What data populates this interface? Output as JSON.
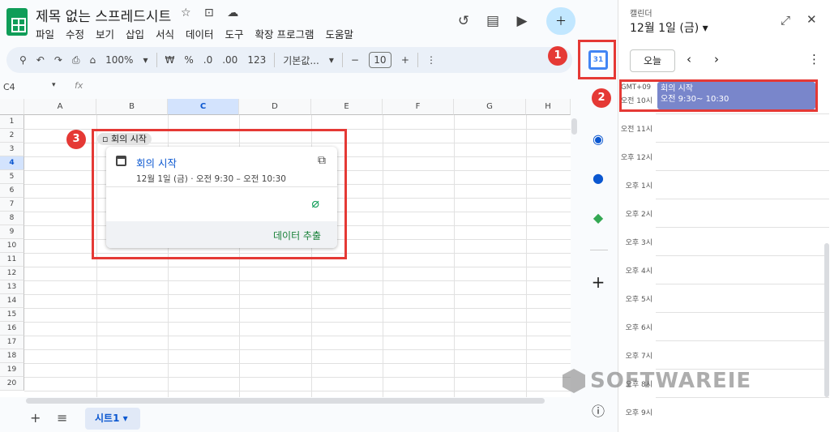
{
  "sheets": {
    "doc_title": "제목 없는 스프레드시트",
    "menu": [
      "파일",
      "수정",
      "보기",
      "삽입",
      "서식",
      "데이터",
      "도구",
      "확장 프로그램",
      "도움말"
    ],
    "toolbar": {
      "zoom": "100%",
      "currency": "₩",
      "percent": "%",
      "dec_minus": ".0",
      "dec_plus": ".00",
      "num123": "123",
      "font": "기본값...",
      "font_size": "10"
    },
    "name_box": "C4",
    "fx": "fx",
    "columns": [
      "A",
      "B",
      "C",
      "D",
      "E",
      "F",
      "G",
      "H"
    ],
    "rows": [
      "1",
      "2",
      "3",
      "4",
      "5",
      "6",
      "7",
      "8",
      "9",
      "10",
      "11",
      "12",
      "13",
      "14",
      "15",
      "16",
      "17",
      "18",
      "19",
      "20"
    ],
    "selected_column": "C",
    "selected_row": "4",
    "chip_label": "회의 시작",
    "popup": {
      "title": "회의 시작",
      "time": "12월 1일 (금) · 오전 9:30 – 오전 10:30",
      "extract_label": "데이터 추출"
    },
    "sheet_tab": "시트1"
  },
  "calendar_panel": {
    "app_label": "캘린더",
    "date": "12월 1일 (금)",
    "today_button": "오늘",
    "timezone": "GMT+09",
    "hours": [
      "오전 10시",
      "오전 11시",
      "오후 12시",
      "오후 1시",
      "오후 2시",
      "오후 3시",
      "오후 4시",
      "오후 5시",
      "오후 6시",
      "오후 7시",
      "오후 8시",
      "오후 9시"
    ],
    "event": {
      "title": "회의 시작",
      "time": "오전 9:30~ 10:30",
      "color": "#7986cb"
    }
  },
  "callouts": [
    "1",
    "2",
    "3"
  ],
  "watermark": "SOFTWAREIE",
  "accent_color": "#e53935"
}
